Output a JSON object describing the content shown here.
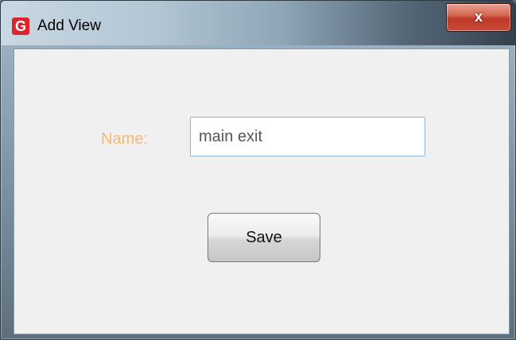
{
  "window": {
    "title": "Add View",
    "app_icon_letter": "G",
    "close_glyph": "x"
  },
  "form": {
    "name_label": "Name:",
    "name_value": "main exit",
    "save_label": "Save"
  },
  "colors": {
    "label_accent": "#f7b87a",
    "app_icon": "#d9252b",
    "close_button": "#c0392b",
    "input_border": "#8fb4d6"
  },
  "icons": {
    "app": "app-logo-icon",
    "close": "close-icon"
  }
}
